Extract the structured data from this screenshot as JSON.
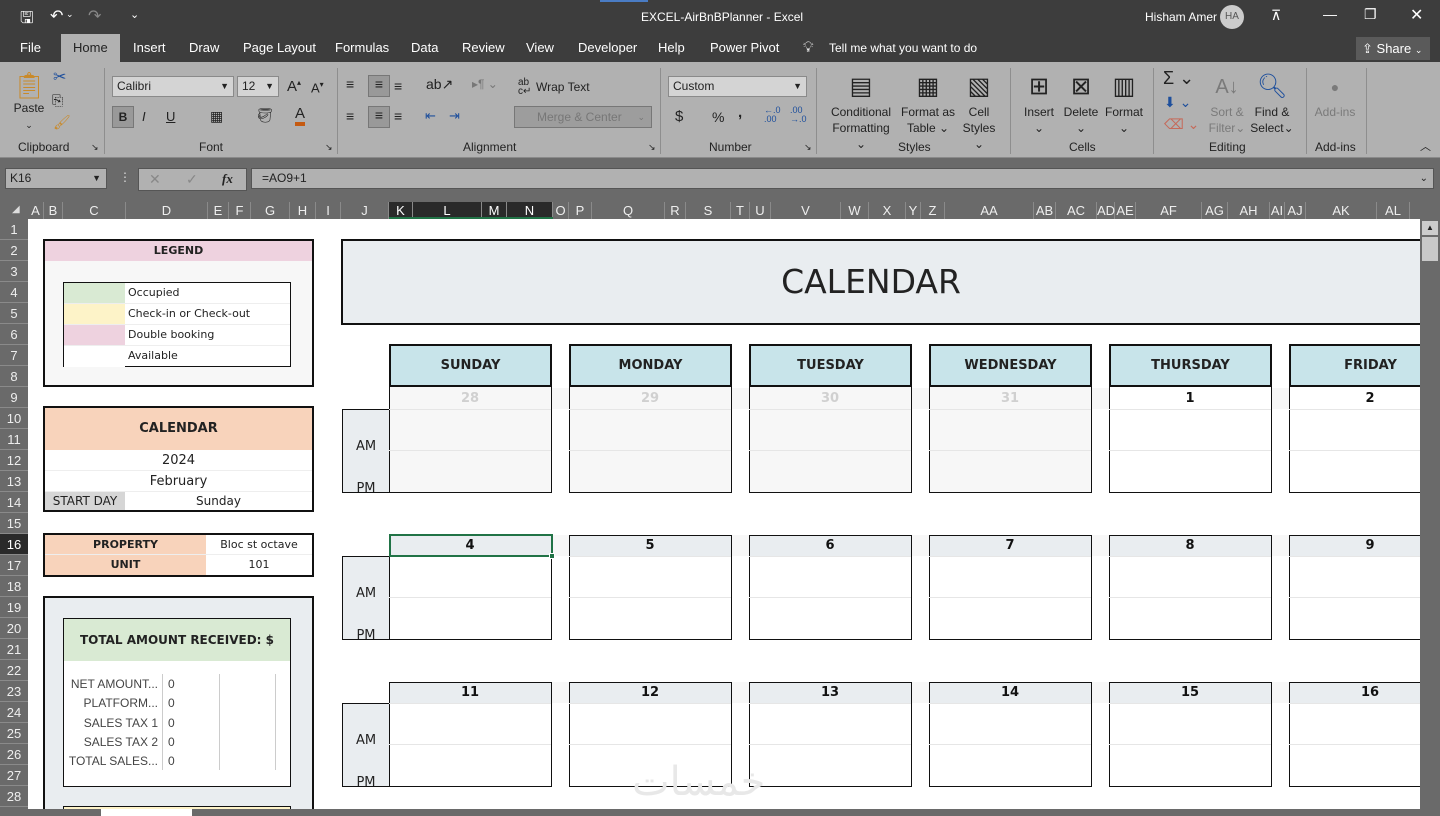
{
  "window": {
    "title": "EXCEL-AirBnBPlanner  -  Excel",
    "user": "Hisham Amer",
    "user_initials": "HA"
  },
  "menu_tabs": [
    "File",
    "Home",
    "Insert",
    "Draw",
    "Page Layout",
    "Formulas",
    "Data",
    "Review",
    "View",
    "Developer",
    "Help",
    "Power Pivot"
  ],
  "tell_me": "Tell me what you want to do",
  "share_label": "Share",
  "ribbon": {
    "clipboard": {
      "paste": "Paste",
      "label": "Clipboard"
    },
    "font": {
      "name": "Calibri",
      "size": "12",
      "bold": "B",
      "italic": "I",
      "underline": "U",
      "label": "Font"
    },
    "alignment": {
      "wrap_text": "Wrap Text",
      "merge_center": "Merge & Center",
      "label": "Alignment"
    },
    "number": {
      "format": "Custom",
      "currency": "$",
      "percent": "%",
      "comma": ",",
      "label": "Number"
    },
    "styles": {
      "conditional": [
        "Conditional",
        "Formatting"
      ],
      "format_table": [
        "Format as",
        "Table"
      ],
      "cell_styles": [
        "Cell",
        "Styles"
      ],
      "label": "Styles"
    },
    "cells": {
      "insert": "Insert",
      "delete": "Delete",
      "format": "Format",
      "label": "Cells"
    },
    "editing": {
      "sort": [
        "Sort &",
        "Filter"
      ],
      "find": [
        "Find &",
        "Select"
      ],
      "label": "Editing"
    },
    "addins": {
      "addins": "Add-ins",
      "label": "Add-ins"
    }
  },
  "formula_bar": {
    "name_box": "K16",
    "formula": "=AO9+1",
    "fx": "fx"
  },
  "columns": [
    "A",
    "B",
    "C",
    "D",
    "E",
    "F",
    "G",
    "H",
    "I",
    "J",
    "K",
    "L",
    "M",
    "N",
    "O",
    "P",
    "Q",
    "R",
    "S",
    "T",
    "U",
    "V",
    "W",
    "X",
    "Y",
    "Z",
    "AA",
    "AB",
    "AC",
    "AD",
    "AE",
    "AF",
    "AG",
    "AH",
    "AI",
    "AJ",
    "AK",
    "AL"
  ],
  "selected_columns": [
    "K",
    "L",
    "M",
    "N"
  ],
  "selected_row": 16,
  "legend": {
    "title": "LEGEND",
    "items": [
      {
        "label": "Occupied",
        "color": "#d9ead3"
      },
      {
        "label": "Check-in or Check-out",
        "color": "#fdf3c8"
      },
      {
        "label": "Double booking",
        "color": "#eed2df"
      },
      {
        "label": "Available",
        "color": "#ffffff"
      }
    ]
  },
  "calendar_settings": {
    "title": "CALENDAR",
    "year": "2024",
    "month": "February",
    "start_day_label": "START DAY",
    "start_day": "Sunday"
  },
  "property": {
    "property_label": "PROPERTY",
    "property_value": "Bloc st octave",
    "unit_label": "UNIT",
    "unit_value": "101"
  },
  "totals": {
    "title": "TOTAL AMOUNT RECEIVED: $",
    "rows": [
      {
        "label": "NET AMOUNT...",
        "value": "0"
      },
      {
        "label": "PLATFORM...",
        "value": "0"
      },
      {
        "label": "SALES TAX 1",
        "value": "0"
      },
      {
        "label": "SALES TAX 2",
        "value": "0"
      },
      {
        "label": "TOTAL SALES...",
        "value": "0"
      }
    ]
  },
  "calendar": {
    "title": "CALENDAR",
    "days": [
      "SUNDAY",
      "MONDAY",
      "TUESDAY",
      "WEDNESDAY",
      "THURSDAY",
      "FRIDAY"
    ],
    "am": "AM",
    "pm": "PM",
    "weeks": [
      {
        "dates": [
          "28",
          "29",
          "30",
          "31",
          "1",
          "2"
        ],
        "muted": [
          true,
          true,
          true,
          true,
          false,
          false
        ]
      },
      {
        "dates": [
          "4",
          "5",
          "6",
          "7",
          "8",
          "9"
        ],
        "muted": [
          false,
          false,
          false,
          false,
          false,
          false
        ]
      },
      {
        "dates": [
          "11",
          "12",
          "13",
          "14",
          "15",
          "16"
        ],
        "muted": [
          false,
          false,
          false,
          false,
          false,
          false
        ]
      }
    ]
  },
  "watermark": "خمسات"
}
